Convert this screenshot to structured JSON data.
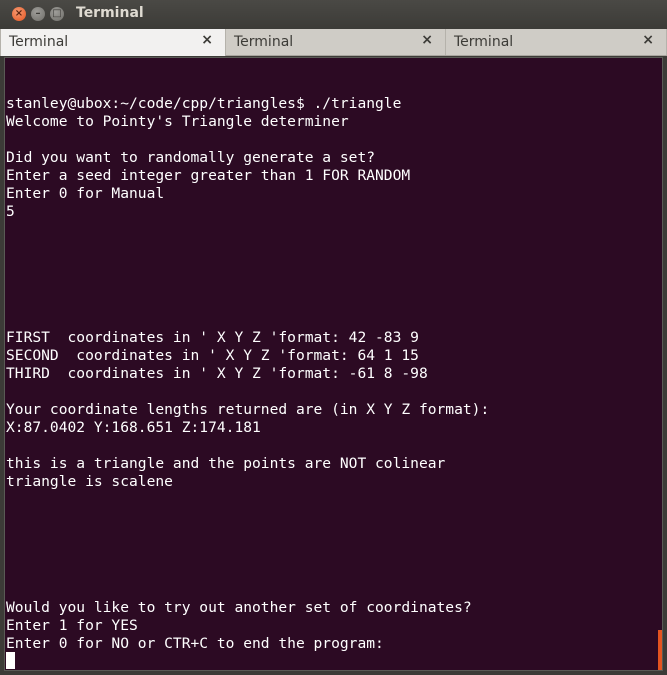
{
  "window": {
    "title": "Terminal"
  },
  "tabs": [
    {
      "label": "Terminal",
      "active": true
    },
    {
      "label": "Terminal",
      "active": false
    },
    {
      "label": "Terminal",
      "active": false
    }
  ],
  "terminal": {
    "lines": [
      "stanley@ubox:~/code/cpp/triangles$ ./triangle",
      "Welcome to Pointy's Triangle determiner",
      "Did you want to randomally generate a set?",
      "Enter a seed integer greater than 1 FOR RANDOM",
      "Enter 0 for Manual",
      "5",
      "FIRST  coordinates in ' X Y Z 'format: 42 -83 9",
      "SECOND  coordinates in ' X Y Z 'format: 64 1 15",
      "THIRD  coordinates in ' X Y Z 'format: -61 8 -98",
      "Your coordinate lengths returned are (in X Y Z format):",
      "X:87.0402 Y:168.651 Z:174.181",
      "this is a triangle and the points are NOT colinear",
      "triangle is scalene",
      "Would you like to try out another set of coordinates?",
      "Enter 1 for YES",
      "Enter 0 for NO or CTR+C to end the program:"
    ]
  },
  "icons": {
    "close": "close-icon",
    "minimize": "minimize-icon",
    "maximize": "maximize-icon"
  },
  "colors": {
    "terminal_bg": "#2c0a23",
    "text": "#ffffff",
    "accent": "#e45420"
  }
}
